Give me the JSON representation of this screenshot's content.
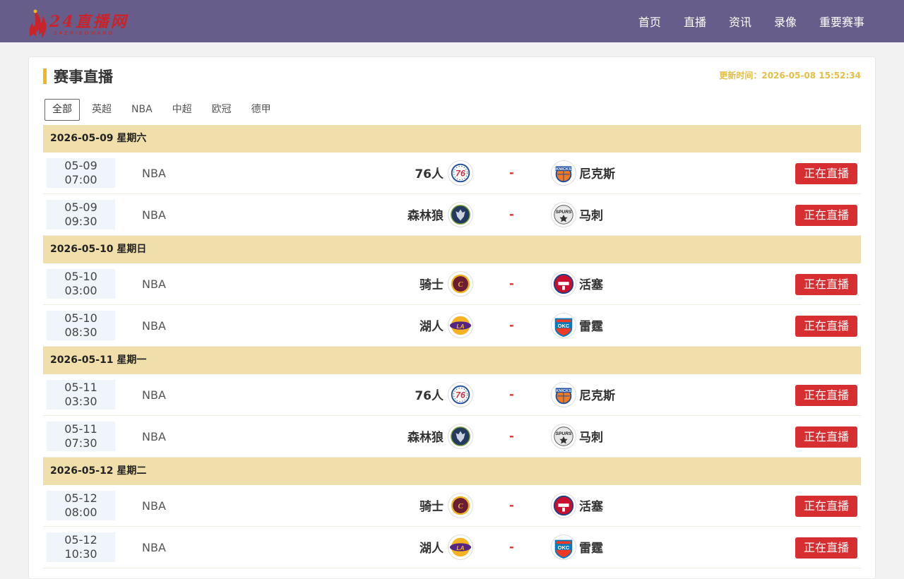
{
  "header": {
    "logo_text": "24直播网",
    "logo_sub": "24ZHIBOWANG",
    "nav": [
      "首页",
      "直播",
      "资讯",
      "录像",
      "重要赛事"
    ]
  },
  "panel": {
    "title": "赛事直播",
    "update_label": "更新时间：2026-05-08 15:52:34"
  },
  "tabs": [
    "全部",
    "英超",
    "NBA",
    "中超",
    "欧冠",
    "德甲"
  ],
  "active_tab": "全部",
  "colors": {
    "header": "#675d8a",
    "accent": "#f0b71e",
    "date_band": "#f0dfab",
    "live_button": "#d72f31"
  },
  "days": [
    {
      "date": "2026-05-09 星期六",
      "matches": [
        {
          "day": "05-09",
          "time": "07:00",
          "league": "NBA",
          "home": "76人",
          "home_logo": "sixers",
          "vs": "-",
          "away": "尼克斯",
          "away_logo": "knicks",
          "status": "正在直播"
        },
        {
          "day": "05-09",
          "time": "09:30",
          "league": "NBA",
          "home": "森林狼",
          "home_logo": "wolves",
          "vs": "-",
          "away": "马刺",
          "away_logo": "spurs",
          "status": "正在直播"
        }
      ]
    },
    {
      "date": "2026-05-10 星期日",
      "matches": [
        {
          "day": "05-10",
          "time": "03:00",
          "league": "NBA",
          "home": "骑士",
          "home_logo": "cavs",
          "vs": "-",
          "away": "活塞",
          "away_logo": "pistons",
          "status": "正在直播"
        },
        {
          "day": "05-10",
          "time": "08:30",
          "league": "NBA",
          "home": "湖人",
          "home_logo": "lakers",
          "vs": "-",
          "away": "雷霆",
          "away_logo": "thunder",
          "status": "正在直播"
        }
      ]
    },
    {
      "date": "2026-05-11 星期一",
      "matches": [
        {
          "day": "05-11",
          "time": "03:30",
          "league": "NBA",
          "home": "76人",
          "home_logo": "sixers",
          "vs": "-",
          "away": "尼克斯",
          "away_logo": "knicks",
          "status": "正在直播"
        },
        {
          "day": "05-11",
          "time": "07:30",
          "league": "NBA",
          "home": "森林狼",
          "home_logo": "wolves",
          "vs": "-",
          "away": "马刺",
          "away_logo": "spurs",
          "status": "正在直播"
        }
      ]
    },
    {
      "date": "2026-05-12 星期二",
      "matches": [
        {
          "day": "05-12",
          "time": "08:00",
          "league": "NBA",
          "home": "骑士",
          "home_logo": "cavs",
          "vs": "-",
          "away": "活塞",
          "away_logo": "pistons",
          "status": "正在直播"
        },
        {
          "day": "05-12",
          "time": "10:30",
          "league": "NBA",
          "home": "湖人",
          "home_logo": "lakers",
          "vs": "-",
          "away": "雷霆",
          "away_logo": "thunder",
          "status": "正在直播"
        }
      ]
    }
  ]
}
